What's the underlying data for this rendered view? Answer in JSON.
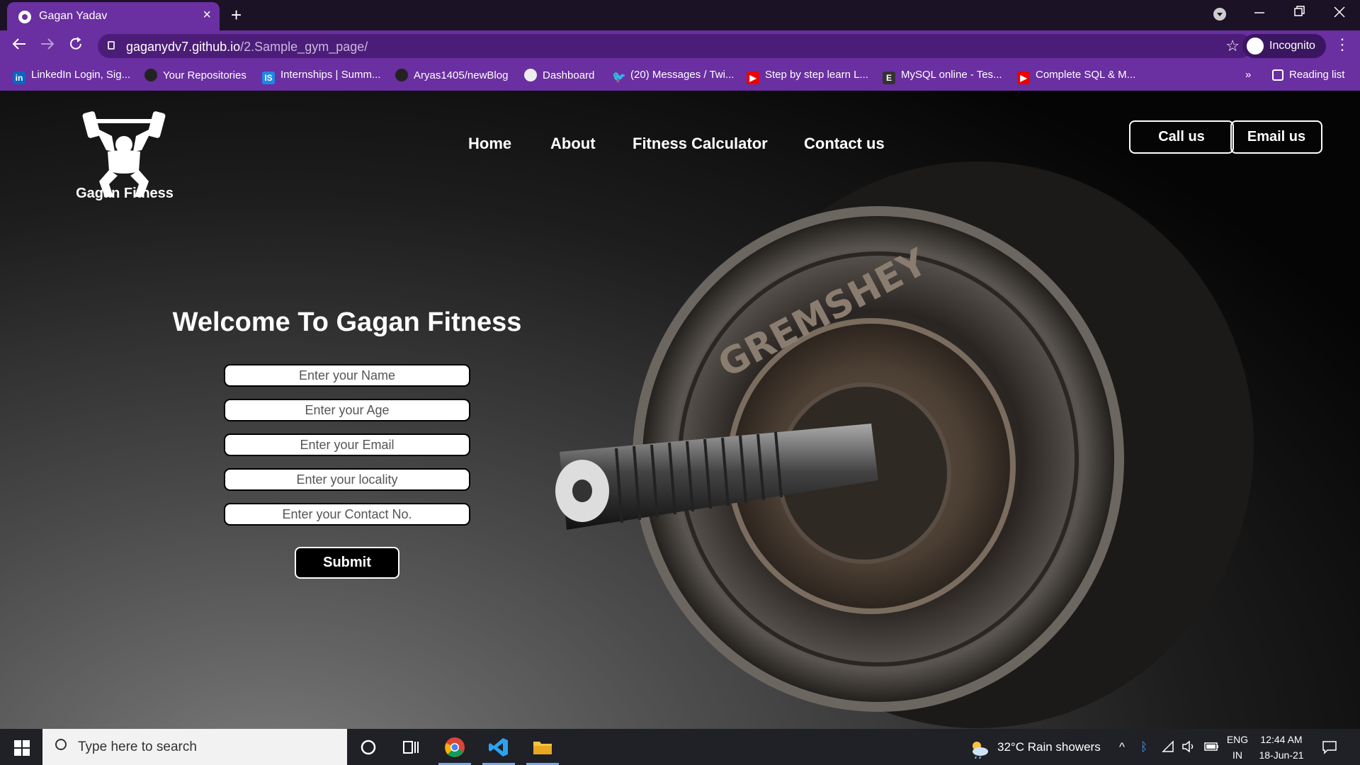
{
  "browser": {
    "tab_title": "Gagan Yadav",
    "tab_close": "×",
    "new_tab": "+",
    "url_host": "gaganydv7.github.io",
    "url_path": "/2.Sample_gym_page/",
    "incognito_label": "Incognito",
    "bookmarks": [
      {
        "label": "LinkedIn Login, Sig...",
        "icon": "linkedin-icon",
        "glyph": "in"
      },
      {
        "label": "Your Repositories",
        "icon": "github-icon",
        "glyph": ""
      },
      {
        "label": "Internships | Summ...",
        "icon": "internshala-icon",
        "glyph": "IS"
      },
      {
        "label": "Aryas1405/newBlog",
        "icon": "github-icon",
        "glyph": ""
      },
      {
        "label": "Dashboard",
        "icon": "globe-icon",
        "glyph": ""
      },
      {
        "label": "(20) Messages / Twi...",
        "icon": "twitter-icon",
        "glyph": "🐦"
      },
      {
        "label": "Step by step learn L...",
        "icon": "youtube-icon",
        "glyph": "▶"
      },
      {
        "label": "MySQL online - Tes...",
        "icon": "e-icon",
        "glyph": "E"
      },
      {
        "label": "Complete SQL & M...",
        "icon": "youtube-icon",
        "glyph": "▶"
      }
    ],
    "overflow": "»",
    "reading_list": "Reading list"
  },
  "site": {
    "brand": "Gagan Fitness",
    "nav": [
      "Home",
      "About",
      "Fitness Calculator",
      "Contact us"
    ],
    "call_button": "Call us",
    "email_button": "Email us",
    "welcome": "Welcome To Gagan Fitness",
    "form": {
      "name_placeholder": "Enter your Name",
      "age_placeholder": "Enter your Age",
      "email_placeholder": "Enter your Email",
      "locality_placeholder": "Enter your locality",
      "contact_placeholder": "Enter your Contact No.",
      "submit": "Submit"
    },
    "plate_text": "GREMSHEY"
  },
  "taskbar": {
    "search_placeholder": "Type here to search",
    "weather": "32°C  Rain showers",
    "lang_top": "ENG",
    "lang_bottom": "IN",
    "time": "12:44 AM",
    "date": "18-Jun-21"
  }
}
